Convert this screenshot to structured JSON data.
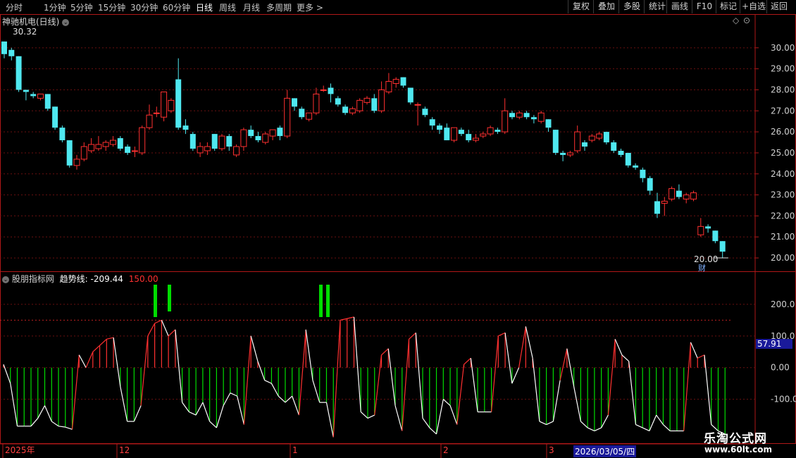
{
  "periods": [
    "分时",
    "1分钟",
    "5分钟",
    "15分钟",
    "30分钟",
    "60分钟",
    "日线",
    "周线",
    "月线",
    "多周期",
    "更多 >"
  ],
  "tools": [
    "复权",
    "叠加",
    "多股",
    "统计",
    "画线",
    "F10",
    "标记",
    "+自选",
    "返回"
  ],
  "stock_title": "神驰机电(日线)",
  "max_marker": "30.32",
  "min_marker": "20.00",
  "cai_badge": "财",
  "indicator": {
    "name": "股朋指标网",
    "line_label": "趋势线:",
    "line_value": "-209.44",
    "other_value": "150.00",
    "cursor_value": "57.91"
  },
  "date_bar": {
    "labels": [
      "2025年",
      "12",
      "1",
      "2",
      "3"
    ],
    "selected": "2026/03/05/四"
  },
  "logo": {
    "text": "乐淘公式网",
    "url": "www.60lt.com"
  },
  "colors": {
    "up": "#ff3030",
    "down": "#4fe8f0",
    "green": "#00dd00",
    "frame": "#b01818"
  },
  "chart_data": [
    {
      "type": "candlestick",
      "y_ticks": [
        "30.00",
        "29.00",
        "28.00",
        "27.00",
        "26.00",
        "25.00",
        "24.00",
        "23.00",
        "22.00",
        "21.00",
        "20.00"
      ],
      "ylim": [
        19.6,
        31.0
      ],
      "candles": [
        {
          "o": 30.3,
          "c": 29.7,
          "h": 30.3,
          "l": 29.5
        },
        {
          "o": 29.9,
          "c": 29.6,
          "h": 30.0,
          "l": 29.4
        },
        {
          "o": 29.6,
          "c": 28.0,
          "h": 29.6,
          "l": 27.9
        },
        {
          "o": 28.0,
          "c": 27.9,
          "h": 28.0,
          "l": 27.5
        },
        {
          "o": 27.8,
          "c": 27.7,
          "h": 27.9,
          "l": 27.6
        },
        {
          "o": 27.6,
          "c": 27.8,
          "h": 27.8,
          "l": 27.5
        },
        {
          "o": 27.8,
          "c": 27.1,
          "h": 27.8,
          "l": 27.0
        },
        {
          "o": 27.2,
          "c": 26.2,
          "h": 27.2,
          "l": 26.1
        },
        {
          "o": 26.2,
          "c": 25.6,
          "h": 26.3,
          "l": 25.5
        },
        {
          "o": 25.6,
          "c": 24.4,
          "h": 25.6,
          "l": 24.3
        },
        {
          "o": 24.4,
          "c": 24.7,
          "h": 24.9,
          "l": 24.2
        },
        {
          "o": 24.7,
          "c": 25.3,
          "h": 25.5,
          "l": 24.6
        },
        {
          "o": 25.1,
          "c": 25.4,
          "h": 25.7,
          "l": 25.0
        },
        {
          "o": 25.2,
          "c": 25.4,
          "h": 25.8,
          "l": 25.1
        },
        {
          "o": 25.3,
          "c": 25.5,
          "h": 25.6,
          "l": 25.1
        },
        {
          "o": 25.4,
          "c": 25.6,
          "h": 25.8,
          "l": 25.3
        },
        {
          "o": 25.7,
          "c": 25.2,
          "h": 25.8,
          "l": 25.1
        },
        {
          "o": 25.3,
          "c": 25.0,
          "h": 25.4,
          "l": 24.9
        },
        {
          "o": 25.1,
          "c": 25.1,
          "h": 25.3,
          "l": 24.8
        },
        {
          "o": 25.0,
          "c": 26.2,
          "h": 26.3,
          "l": 24.9
        },
        {
          "o": 26.2,
          "c": 26.8,
          "h": 27.3,
          "l": 26.1
        },
        {
          "o": 26.9,
          "c": 26.9,
          "h": 27.2,
          "l": 26.7
        },
        {
          "o": 26.7,
          "c": 27.9,
          "h": 27.9,
          "l": 26.5
        },
        {
          "o": 27.0,
          "c": 27.5,
          "h": 27.6,
          "l": 26.9
        },
        {
          "o": 28.5,
          "c": 26.2,
          "h": 29.5,
          "l": 26.1
        },
        {
          "o": 26.3,
          "c": 26.1,
          "h": 26.6,
          "l": 25.9
        },
        {
          "o": 25.9,
          "c": 25.2,
          "h": 26.0,
          "l": 25.1
        },
        {
          "o": 25.0,
          "c": 25.3,
          "h": 25.5,
          "l": 24.8
        },
        {
          "o": 25.1,
          "c": 25.3,
          "h": 25.5,
          "l": 24.9
        },
        {
          "o": 25.9,
          "c": 25.2,
          "h": 25.9,
          "l": 25.1
        },
        {
          "o": 25.2,
          "c": 25.8,
          "h": 25.9,
          "l": 25.1
        },
        {
          "o": 25.8,
          "c": 25.3,
          "h": 25.9,
          "l": 25.1
        },
        {
          "o": 24.9,
          "c": 25.3,
          "h": 25.4,
          "l": 24.8
        },
        {
          "o": 25.3,
          "c": 26.1,
          "h": 26.2,
          "l": 25.1
        },
        {
          "o": 26.1,
          "c": 25.8,
          "h": 26.3,
          "l": 25.7
        },
        {
          "o": 25.8,
          "c": 25.6,
          "h": 26.0,
          "l": 25.5
        },
        {
          "o": 25.5,
          "c": 25.9,
          "h": 26.0,
          "l": 25.4
        },
        {
          "o": 25.8,
          "c": 26.1,
          "h": 26.1,
          "l": 25.6
        },
        {
          "o": 26.2,
          "c": 25.8,
          "h": 26.3,
          "l": 25.6
        },
        {
          "o": 25.8,
          "c": 27.6,
          "h": 28.0,
          "l": 25.7
        },
        {
          "o": 27.6,
          "c": 27.2,
          "h": 27.6,
          "l": 27.0
        },
        {
          "o": 27.1,
          "c": 26.7,
          "h": 27.2,
          "l": 26.6
        },
        {
          "o": 26.6,
          "c": 26.9,
          "h": 26.9,
          "l": 26.5
        },
        {
          "o": 26.9,
          "c": 27.8,
          "h": 28.1,
          "l": 26.8
        },
        {
          "o": 28.0,
          "c": 28.0,
          "h": 28.2,
          "l": 27.9
        },
        {
          "o": 28.1,
          "c": 27.8,
          "h": 28.3,
          "l": 27.4
        },
        {
          "o": 27.6,
          "c": 27.3,
          "h": 27.7,
          "l": 27.2
        },
        {
          "o": 27.2,
          "c": 26.9,
          "h": 27.3,
          "l": 26.8
        },
        {
          "o": 26.9,
          "c": 27.1,
          "h": 27.2,
          "l": 26.8
        },
        {
          "o": 27.0,
          "c": 27.5,
          "h": 27.6,
          "l": 26.9
        },
        {
          "o": 27.4,
          "c": 27.6,
          "h": 27.7,
          "l": 27.3
        },
        {
          "o": 27.6,
          "c": 27.0,
          "h": 27.8,
          "l": 26.9
        },
        {
          "o": 27.0,
          "c": 28.0,
          "h": 28.4,
          "l": 26.9
        },
        {
          "o": 27.9,
          "c": 28.4,
          "h": 28.8,
          "l": 27.8
        },
        {
          "o": 28.3,
          "c": 28.5,
          "h": 28.6,
          "l": 28.1
        },
        {
          "o": 28.6,
          "c": 28.2,
          "h": 28.6,
          "l": 28.1
        },
        {
          "o": 28.1,
          "c": 27.4,
          "h": 28.1,
          "l": 27.3
        },
        {
          "o": 27.3,
          "c": 27.3,
          "h": 27.4,
          "l": 26.3
        },
        {
          "o": 27.1,
          "c": 26.8,
          "h": 27.2,
          "l": 26.7
        },
        {
          "o": 26.6,
          "c": 26.3,
          "h": 26.7,
          "l": 26.1
        },
        {
          "o": 26.3,
          "c": 26.1,
          "h": 26.4,
          "l": 25.9
        },
        {
          "o": 26.2,
          "c": 25.6,
          "h": 26.4,
          "l": 25.6
        },
        {
          "o": 25.6,
          "c": 26.2,
          "h": 26.2,
          "l": 25.5
        },
        {
          "o": 26.1,
          "c": 25.9,
          "h": 26.2,
          "l": 25.8
        },
        {
          "o": 25.9,
          "c": 25.6,
          "h": 26.1,
          "l": 25.5
        },
        {
          "o": 25.6,
          "c": 25.7,
          "h": 25.9,
          "l": 25.5
        },
        {
          "o": 25.8,
          "c": 25.9,
          "h": 26.0,
          "l": 25.7
        },
        {
          "o": 25.9,
          "c": 26.2,
          "h": 26.3,
          "l": 25.8
        },
        {
          "o": 26.1,
          "c": 26.0,
          "h": 26.2,
          "l": 25.9
        },
        {
          "o": 26.0,
          "c": 27.0,
          "h": 27.6,
          "l": 25.9
        },
        {
          "o": 26.9,
          "c": 26.7,
          "h": 27.0,
          "l": 26.6
        },
        {
          "o": 26.7,
          "c": 26.9,
          "h": 27.0,
          "l": 26.6
        },
        {
          "o": 26.9,
          "c": 26.7,
          "h": 27.0,
          "l": 26.6
        },
        {
          "o": 26.7,
          "c": 26.6,
          "h": 26.8,
          "l": 26.4
        },
        {
          "o": 26.5,
          "c": 26.9,
          "h": 27.0,
          "l": 26.4
        },
        {
          "o": 26.6,
          "c": 26.2,
          "h": 26.6,
          "l": 26.0
        },
        {
          "o": 26.1,
          "c": 25.0,
          "h": 26.1,
          "l": 24.9
        },
        {
          "o": 25.0,
          "c": 24.9,
          "h": 25.1,
          "l": 24.6
        },
        {
          "o": 24.9,
          "c": 25.0,
          "h": 25.1,
          "l": 24.8
        },
        {
          "o": 25.1,
          "c": 26.0,
          "h": 26.3,
          "l": 25.0
        },
        {
          "o": 25.5,
          "c": 25.3,
          "h": 25.6,
          "l": 25.1
        },
        {
          "o": 25.6,
          "c": 25.8,
          "h": 25.9,
          "l": 25.5
        },
        {
          "o": 25.7,
          "c": 25.9,
          "h": 26.0,
          "l": 25.6
        },
        {
          "o": 26.0,
          "c": 25.5,
          "h": 26.0,
          "l": 25.4
        },
        {
          "o": 25.5,
          "c": 25.1,
          "h": 25.6,
          "l": 25.0
        },
        {
          "o": 25.1,
          "c": 24.9,
          "h": 25.2,
          "l": 24.8
        },
        {
          "o": 25.0,
          "c": 24.4,
          "h": 25.0,
          "l": 24.3
        },
        {
          "o": 24.4,
          "c": 24.3,
          "h": 24.5,
          "l": 24.2
        },
        {
          "o": 24.2,
          "c": 23.8,
          "h": 24.3,
          "l": 23.6
        },
        {
          "o": 23.8,
          "c": 23.2,
          "h": 23.9,
          "l": 23.0
        },
        {
          "o": 22.7,
          "c": 22.1,
          "h": 23.1,
          "l": 21.9
        },
        {
          "o": 22.6,
          "c": 22.7,
          "h": 22.9,
          "l": 22.0
        },
        {
          "o": 22.8,
          "c": 23.3,
          "h": 23.4,
          "l": 22.7
        },
        {
          "o": 23.2,
          "c": 22.9,
          "h": 23.5,
          "l": 22.8
        },
        {
          "o": 22.8,
          "c": 23.0,
          "h": 23.1,
          "l": 22.6
        },
        {
          "o": 22.8,
          "c": 23.1,
          "h": 23.2,
          "l": 22.7
        },
        {
          "o": 21.1,
          "c": 21.5,
          "h": 21.9,
          "l": 21.0
        },
        {
          "o": 21.5,
          "c": 21.4,
          "h": 21.6,
          "l": 21.2
        },
        {
          "o": 21.3,
          "c": 20.8,
          "h": 21.3,
          "l": 20.7
        },
        {
          "o": 20.8,
          "c": 20.3,
          "h": 20.8,
          "l": 20.0
        }
      ]
    },
    {
      "type": "bar+line",
      "y_ticks": [
        "200.0",
        "100.0",
        "0.00",
        "-100.0"
      ],
      "ylim": [
        -230,
        280
      ],
      "trend": [
        10,
        -50,
        -185,
        -185,
        -185,
        -160,
        -120,
        -170,
        -185,
        -188,
        -195,
        40,
        0,
        50,
        70,
        90,
        95,
        -60,
        -170,
        -170,
        -120,
        100,
        140,
        150,
        100,
        120,
        -110,
        -140,
        -150,
        -110,
        -170,
        -190,
        -120,
        -80,
        -90,
        -180,
        100,
        20,
        -40,
        -50,
        -90,
        -110,
        -90,
        -150,
        120,
        -40,
        -110,
        -110,
        -220,
        150,
        155,
        160,
        -140,
        -160,
        -150,
        40,
        60,
        -120,
        -200,
        90,
        110,
        -160,
        -190,
        -210,
        -100,
        -120,
        -180,
        10,
        30,
        -140,
        -140,
        -140,
        100,
        110,
        -50,
        0,
        130,
        30,
        -170,
        -180,
        -170,
        -40,
        60,
        -60,
        -170,
        -190,
        -200,
        -190,
        -150,
        90,
        40,
        20,
        -180,
        -190,
        -200,
        -150,
        -180,
        -200,
        -200,
        -200,
        80,
        30,
        40,
        -180,
        -200,
        -210
      ]
    }
  ]
}
